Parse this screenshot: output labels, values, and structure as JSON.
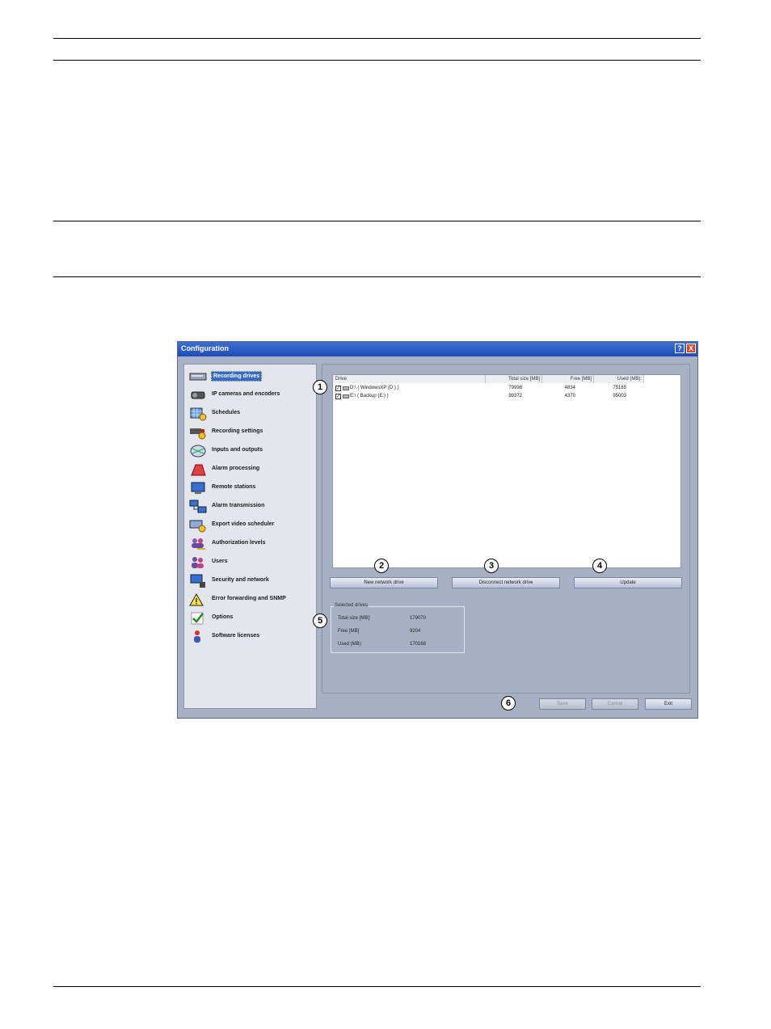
{
  "window": {
    "title": "Configuration",
    "help_label": "?",
    "close_label": "X"
  },
  "sidebar": {
    "items": [
      {
        "label": "Recording drives",
        "icon": "hard-drive-icon"
      },
      {
        "label": "IP cameras and encoders",
        "icon": "camera-icon"
      },
      {
        "label": "Schedules",
        "icon": "schedule-grid-icon"
      },
      {
        "label": "Recording settings",
        "icon": "camera-clock-icon"
      },
      {
        "label": "Inputs and outputs",
        "icon": "inputs-outputs-icon"
      },
      {
        "label": "Alarm processing",
        "icon": "alarm-icon"
      },
      {
        "label": "Remote stations",
        "icon": "monitor-icon"
      },
      {
        "label": "Alarm transmission",
        "icon": "network-computers-icon"
      },
      {
        "label": "Export video scheduler",
        "icon": "export-clock-icon"
      },
      {
        "label": "Authorization levels",
        "icon": "user-group-key-icon"
      },
      {
        "label": "Users",
        "icon": "users-icon"
      },
      {
        "label": "Security and network",
        "icon": "secure-computer-icon"
      },
      {
        "label": "Error forwarding and SNMP",
        "icon": "warning-icon"
      },
      {
        "label": "Options",
        "icon": "checkmark-icon"
      },
      {
        "label": "Software licenses",
        "icon": "license-user-icon"
      }
    ]
  },
  "drives": {
    "headers": [
      "Drive",
      "Total size [MB]",
      "Free [MB]",
      "Used (MB):"
    ],
    "rows": [
      {
        "check": "✓",
        "drive": "D:\\ ( WindowsXP (D:) )",
        "total": "79998",
        "free": "4834",
        "used": "75165"
      },
      {
        "check": "✓",
        "drive": "E:\\ ( Backup (E:) )",
        "total": "99372",
        "free": "4370",
        "used": "95003"
      }
    ]
  },
  "buttons": {
    "new_network_drive": "New network drive",
    "disconnect_network_drive": "Disconnect network drive",
    "update": "Update",
    "save": "Save",
    "cancel": "Cancel",
    "exit": "Exit"
  },
  "selected_drives": {
    "title": "Selected drives",
    "total_label": "Total size [MB]:",
    "total_value": "179070",
    "free_label": "Free [MB]",
    "free_value": "9204",
    "used_label": "Used (MB):",
    "used_value": "170168"
  },
  "callouts": [
    "1",
    "2",
    "3",
    "4",
    "5",
    "6"
  ]
}
